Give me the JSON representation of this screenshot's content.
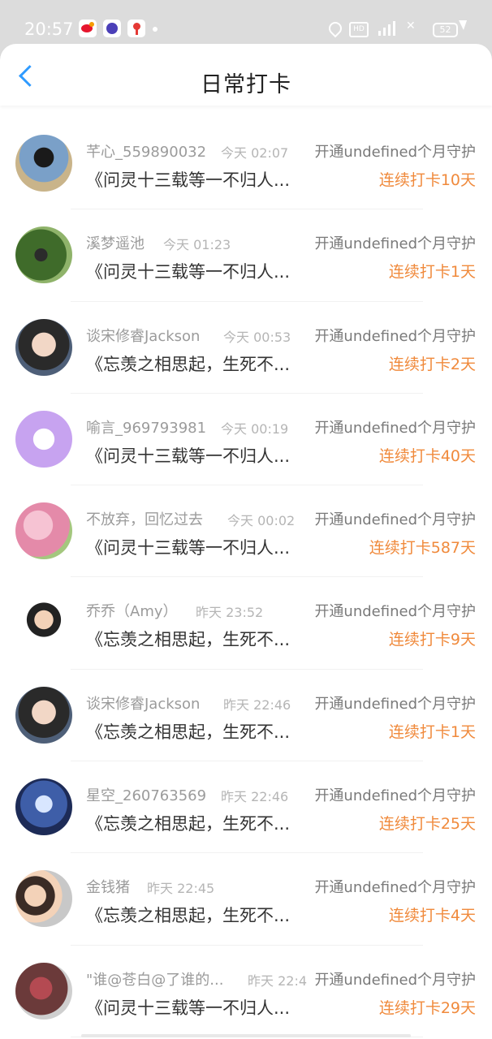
{
  "status_bar": {
    "time": "20:57",
    "hd_label": "HD",
    "battery": "52",
    "icons": [
      "weibo-icon",
      "app-circle-icon",
      "map-pin-icon",
      "location-icon",
      "hd-icon",
      "signal-icon",
      "battery-icon",
      "charging-icon"
    ]
  },
  "header": {
    "title": "日常打卡",
    "back_icon": "chevron-left-icon"
  },
  "colors": {
    "accent_blue": "#2f9bff",
    "streak_orange": "#f08a3c",
    "name_gray": "#9b9b9b",
    "time_gray": "#b5b5b5"
  },
  "items": [
    {
      "name": "芊心_559890032",
      "time": "今天 02:07",
      "guard": "开通undefined个月守护",
      "book": "《问灵十三载等一不归人...",
      "streak": "连续打卡10天"
    },
    {
      "name": "溪梦遥池",
      "time": "今天 01:23",
      "guard": "开通undefined个月守护",
      "book": "《问灵十三载等一不归人...",
      "streak": "连续打卡1天"
    },
    {
      "name": "谈宋修睿Jackson",
      "time": "今天 00:53",
      "guard": "开通undefined个月守护",
      "book": "《忘羡之相思起，生死不...",
      "streak": "连续打卡2天"
    },
    {
      "name": "喻言_969793981",
      "time": "今天 00:19",
      "guard": "开通undefined个月守护",
      "book": "《问灵十三载等一不归人...",
      "streak": "连续打卡40天"
    },
    {
      "name": "不放弃，回忆过去",
      "time": "今天 00:02",
      "guard": "开通undefined个月守护",
      "book": "《问灵十三载等一不归人...",
      "streak": "连续打卡587天"
    },
    {
      "name": "乔乔（Amy）",
      "time": "昨天 23:52",
      "guard": "开通undefined个月守护",
      "book": "《忘羡之相思起，生死不...",
      "streak": "连续打卡9天"
    },
    {
      "name": "谈宋修睿Jackson",
      "time": "昨天 22:46",
      "guard": "开通undefined个月守护",
      "book": "《忘羡之相思起，生死不...",
      "streak": "连续打卡1天"
    },
    {
      "name": "星空_260763569",
      "time": "昨天 22:46",
      "guard": "开通undefined个月守护",
      "book": "《忘羡之相思起，生死不...",
      "streak": "连续打卡25天"
    },
    {
      "name": "金钱猪",
      "time": "昨天 22:45",
      "guard": "开通undefined个月守护",
      "book": "《忘羡之相思起，生死不...",
      "streak": "连续打卡4天"
    },
    {
      "name": "\"谁@苍白@了谁的...",
      "time": "昨天 22:4",
      "guard": "开通undefined个月守护",
      "book": "《问灵十三载等一不归人...",
      "streak": "连续打卡29天"
    }
  ]
}
